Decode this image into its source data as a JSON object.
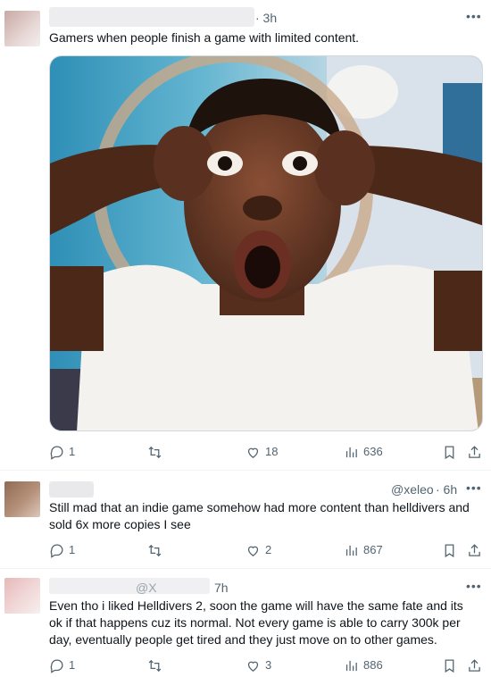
{
  "posts": [
    {
      "time": "· 3h",
      "handle": "",
      "more": "•••",
      "text": "Gamers when people finish a game with limited content.",
      "media": "image",
      "stats": {
        "reply": "1",
        "repost": "",
        "like": "18",
        "views": "636"
      }
    },
    {
      "time": "· 6h",
      "handle": "@xeleo",
      "more": "•••",
      "text": "Still mad that an indie game somehow had more content than helldivers and sold 6x more copies I see",
      "stats": {
        "reply": "1",
        "repost": "",
        "like": "2",
        "views": "867"
      }
    },
    {
      "time": "7h",
      "handle": "@X",
      "more": "•••",
      "text": "Even tho i liked Helldivers 2, soon the game will have the same fate and its ok if that happens cuz its normal. Not every game is able to carry 300k per day, eventually people get tired and they just move on to other games.",
      "stats": {
        "reply": "1",
        "repost": "",
        "like": "3",
        "views": "886"
      }
    }
  ],
  "icons": {
    "reply": "reply-icon",
    "repost": "repost-icon",
    "like": "like-icon",
    "views": "views-icon",
    "bookmark": "bookmark-icon",
    "share": "share-icon"
  },
  "colors": {
    "icon": "#536471",
    "divider": "#eff3f4",
    "text": "#0f1419"
  }
}
